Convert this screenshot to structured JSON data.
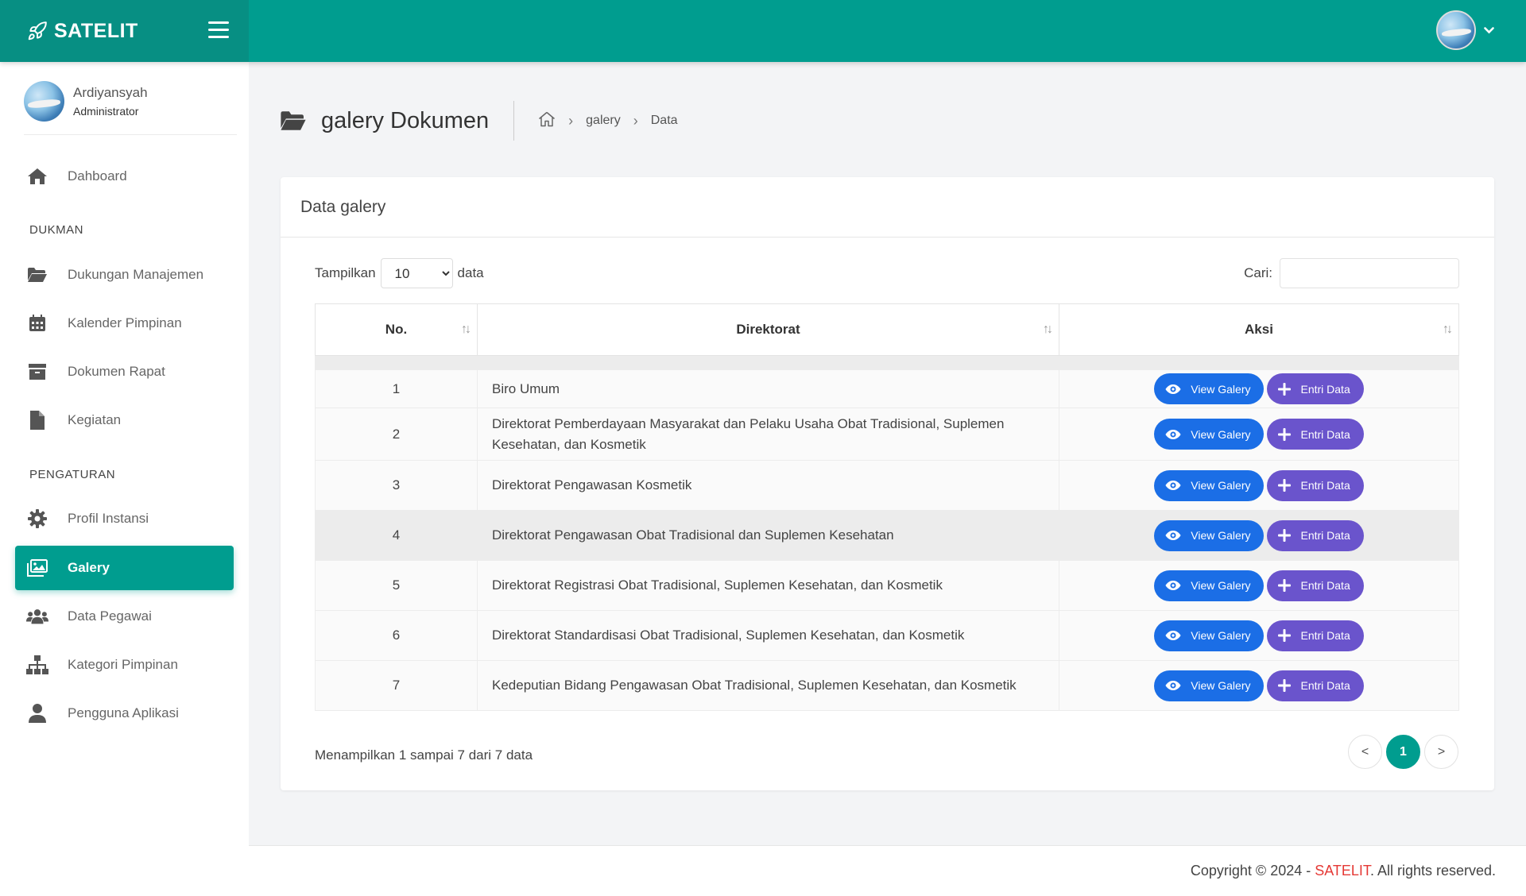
{
  "app": {
    "brand": "SATELIT",
    "colors": {
      "primary": "#009d8f",
      "view_button": "#1b6ee6",
      "entri_button": "#6a54cc",
      "footer_brand": "#e53935"
    }
  },
  "user": {
    "name": "Ardiyansyah",
    "role": "Administrator"
  },
  "sidebar": {
    "dashboard": "Dahboard",
    "sections": [
      "DUKMAN",
      "PENGATURAN"
    ],
    "dukman_items": [
      "Dukungan Manajemen",
      "Kalender Pimpinan",
      "Dokumen Rapat",
      "Kegiatan"
    ],
    "pengaturan_items": [
      "Profil Instansi",
      "Galery",
      "Data Pegawai",
      "Kategori Pimpinan",
      "Pengguna Aplikasi"
    ],
    "active": "Galery"
  },
  "page": {
    "title": "galery Dokumen",
    "breadcrumb": [
      "galery",
      "Data"
    ]
  },
  "card": {
    "title": "Data galery",
    "length_label_before": "Tampilkan",
    "length_value": "10",
    "length_options": [
      "10"
    ],
    "length_label_after": "data",
    "search_label": "Cari:",
    "search_value": "",
    "columns": [
      "No.",
      "Direktorat",
      "Aksi"
    ],
    "rows": [
      {
        "no": "1",
        "direktorat": "Biro Umum"
      },
      {
        "no": "2",
        "direktorat": "Direktorat Pemberdayaan Masyarakat dan Pelaku Usaha Obat Tradisional, Suplemen Kesehatan, dan Kosmetik"
      },
      {
        "no": "3",
        "direktorat": "Direktorat Pengawasan Kosmetik"
      },
      {
        "no": "4",
        "direktorat": "Direktorat Pengawasan Obat Tradisional dan Suplemen Kesehatan"
      },
      {
        "no": "5",
        "direktorat": "Direktorat Registrasi Obat Tradisional, Suplemen Kesehatan, dan Kosmetik"
      },
      {
        "no": "6",
        "direktorat": "Direktorat Standardisasi Obat Tradisional, Suplemen Kesehatan, dan Kosmetik"
      },
      {
        "no": "7",
        "direktorat": "Kedeputian Bidang Pengawasan Obat Tradisional, Suplemen Kesehatan, dan Kosmetik"
      }
    ],
    "view_label": "View Galery",
    "entri_label": "Entri Data",
    "info": "Menampilkan 1 sampai 7 dari 7 data",
    "pager": {
      "prev": "<",
      "current": "1",
      "next": ">"
    }
  },
  "footer": {
    "prefix": "Copyright © 2024 - ",
    "brand": "SATELIT",
    "suffix": ". All rights reserved."
  }
}
